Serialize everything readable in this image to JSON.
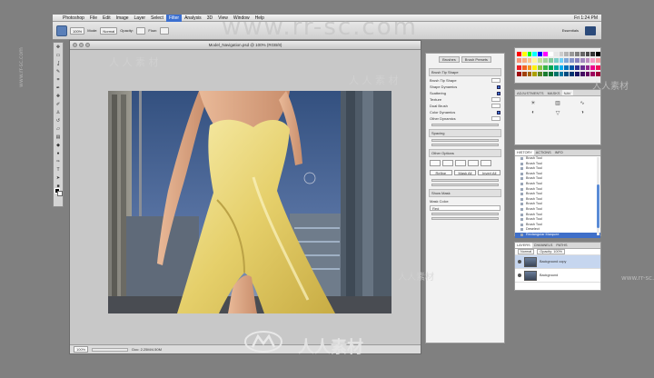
{
  "menubar": {
    "apple_glyph": "",
    "items": [
      "Photoshop",
      "File",
      "Edit",
      "Image",
      "Layer",
      "Select",
      "Filter",
      "Analysis",
      "3D",
      "View",
      "Window",
      "Help"
    ],
    "active_item": "Filter",
    "clock": "Fri 1:24 PM"
  },
  "options_bar": {
    "size": "100%",
    "mode_label": "Mode:",
    "mode_value": "Normal",
    "opacity_label": "Opacity:",
    "flow_label": "Flow:",
    "workspace": "Essentials"
  },
  "document": {
    "title": "Model_Navigation.psd @ 100% (RGB/8)",
    "zoom": "100%",
    "status": "Doc: 2.25M/4.50M"
  },
  "brush_panel": {
    "tabs": [
      "Brushes",
      "Brush Presets"
    ],
    "rows": [
      {
        "label": "Brush Tip Shape",
        "checked": false
      },
      {
        "label": "Shape Dynamics",
        "checked": true
      },
      {
        "label": "Scattering",
        "checked": true
      },
      {
        "label": "Texture",
        "checked": false
      },
      {
        "label": "Dual Brush",
        "checked": false
      },
      {
        "label": "Color Dynamics",
        "checked": true
      },
      {
        "label": "Other Dynamics",
        "checked": false
      }
    ],
    "section_1": "Brush Tip Shape",
    "section_2": "Spacing",
    "section_3": "Other Options",
    "section_4": "Show Mask",
    "mask_mode_label": "Mask Color:",
    "mask_mode_value": "Red",
    "buttons": [
      "Refine",
      "Mask All",
      "Invert All"
    ]
  },
  "adjustments": {
    "tabs": [
      "ADJUSTMENTS",
      "MASKS",
      "NAV"
    ],
    "active_tab": "NAV"
  },
  "history": {
    "tabs": [
      "HISTORY",
      "ACTIONS",
      "INFO"
    ],
    "active_tab": "HISTORY",
    "items": [
      "Brush Tool",
      "Brush Tool",
      "Brush Tool",
      "Brush Tool",
      "Brush Tool",
      "Brush Tool",
      "Brush Tool",
      "Brush Tool",
      "Brush Tool",
      "Brush Tool",
      "Brush Tool",
      "Brush Tool",
      "Brush Tool",
      "Brush Tool",
      "Deselect",
      "Rectangular Marquee"
    ],
    "active_index": 15
  },
  "layers": {
    "tabs": [
      "LAYERS",
      "CHANNELS",
      "PATHS"
    ],
    "active_tab": "LAYERS",
    "mode": "Normal",
    "opacity_label": "Opacity: 100%",
    "items": [
      {
        "name": "Background copy",
        "selected": true
      },
      {
        "name": "Background",
        "selected": false
      }
    ]
  },
  "watermarks": {
    "url": "www.rr-sc.com",
    "site_chars": "人人素材",
    "site_chars_spaced": "人 人 素 材",
    "small_url": "www.rr-sc.com"
  },
  "colors": {
    "menu_active": "#3b6fd0",
    "history_active": "#3f6fc9",
    "sky": "#3f5f96",
    "dress": "#e9d77a"
  },
  "swatches": [
    "#ff0000",
    "#ffff00",
    "#00ff00",
    "#00ffff",
    "#0000ff",
    "#ff00ff",
    "#ffffff",
    "#e6e6e6",
    "#cccccc",
    "#b3b3b3",
    "#999999",
    "#808080",
    "#666666",
    "#4d4d4d",
    "#333333",
    "#000000",
    "#f7977a",
    "#f9ad81",
    "#fdc68a",
    "#fff79a",
    "#c4df9b",
    "#a2d39c",
    "#82ca9d",
    "#7bcdc8",
    "#6ecff6",
    "#7ea7d8",
    "#8493ca",
    "#8882be",
    "#a187be",
    "#bc8dbf",
    "#f49ac2",
    "#f6989d",
    "#ed1c24",
    "#f26522",
    "#f7941d",
    "#fff200",
    "#8dc63f",
    "#39b54a",
    "#00a651",
    "#00a99d",
    "#00aeef",
    "#0072bc",
    "#0054a6",
    "#2e3192",
    "#662d91",
    "#92278f",
    "#ec008c",
    "#ed145b",
    "#9e0b0f",
    "#a0410d",
    "#a3620a",
    "#aba000",
    "#598527",
    "#1a7b30",
    "#007236",
    "#00746b",
    "#0076a3",
    "#004b80",
    "#003471",
    "#1b1464",
    "#440e62",
    "#630460",
    "#9e005d",
    "#9e0039"
  ]
}
